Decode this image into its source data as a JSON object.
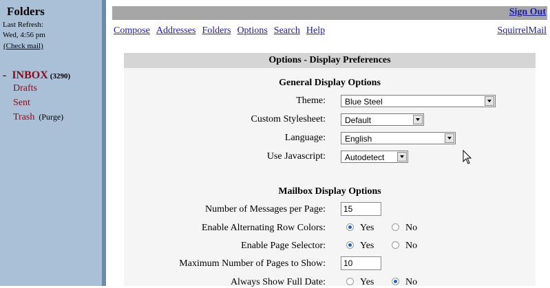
{
  "folders": {
    "title": "Folders",
    "last_refresh_label": "Last Refresh:",
    "last_refresh_time": "Wed, 4:56 pm",
    "check_mail": "(Check mail)",
    "inbox": {
      "dash": "-",
      "label": "INBOX",
      "count": "(3290)"
    },
    "drafts": "Drafts",
    "sent": "Sent",
    "trash": {
      "label": "Trash",
      "purge": "(Purge)"
    }
  },
  "top": {
    "sign_out": "Sign Out",
    "nav": [
      "Compose",
      "Addresses",
      "Folders",
      "Options",
      "Search",
      "Help"
    ],
    "brand_link": "SquirrelMail"
  },
  "panel": {
    "title": "Options - Display Preferences",
    "general": {
      "heading": "General Display Options",
      "theme": {
        "label": "Theme:",
        "value": "Blue Steel"
      },
      "stylesheet": {
        "label": "Custom Stylesheet:",
        "value": "Default"
      },
      "language": {
        "label": "Language:",
        "value": "English"
      },
      "javascript": {
        "label": "Use Javascript:",
        "value": "Autodetect"
      }
    },
    "mailbox": {
      "heading": "Mailbox Display Options",
      "messages_per_page": {
        "label": "Number of Messages per Page:",
        "value": "15"
      },
      "alt_row_colors": {
        "label": "Enable Alternating Row Colors:",
        "yes": "Yes",
        "no": "No",
        "selected": "yes"
      },
      "page_selector": {
        "label": "Enable Page Selector:",
        "yes": "Yes",
        "no": "No",
        "selected": "yes"
      },
      "max_pages": {
        "label": "Maximum Number of Pages to Show:",
        "value": "10"
      },
      "full_date": {
        "label": "Always Show Full Date:",
        "yes": "Yes",
        "no": "No",
        "selected": "no"
      }
    }
  },
  "colors": {
    "sidebar": "#a9c0d6",
    "divider": "#6d8bad",
    "topbar": "#a6a6a6",
    "link": "#1a1aa8",
    "folder": "#8b0a1a"
  }
}
